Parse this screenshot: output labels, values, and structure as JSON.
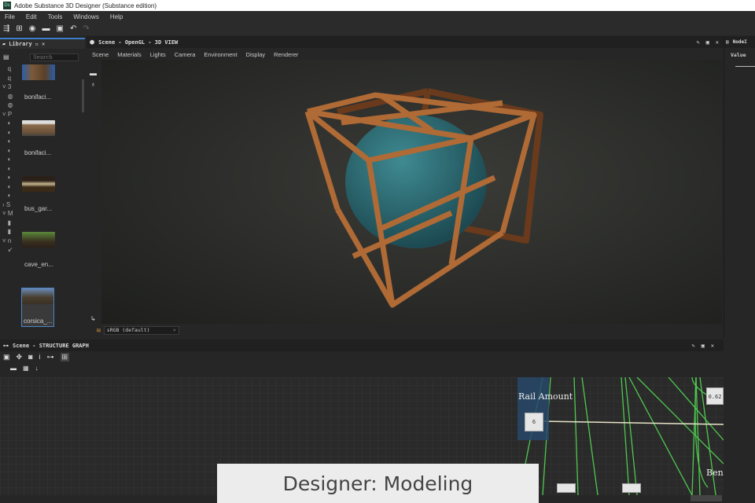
{
  "window": {
    "title": "Adobe Substance 3D Designer (Substance edition)",
    "logo": "Ds"
  },
  "menu": [
    "File",
    "Edit",
    "Tools",
    "Windows",
    "Help"
  ],
  "library": {
    "tab": "Library",
    "search_placeholder": "Search",
    "items": [
      "bonifaci...",
      "bonifaci...",
      "bus_gar...",
      "cave_en...",
      "corsica_..."
    ]
  },
  "scene": {
    "title": "Scene - OpenGL - 3D VIEW",
    "menu": [
      "Scene",
      "Materials",
      "Lights",
      "Camera",
      "Environment",
      "Display",
      "Renderer"
    ],
    "colorspace": "sRGB (default)"
  },
  "right_panel": {
    "title": "NodeI",
    "column": "Value"
  },
  "graph": {
    "title": "Scene - STRUCTURE GRAPH",
    "node_label": "Rail Amount",
    "node_value": "6",
    "node_b": "Ben",
    "node_c": "0.62"
  },
  "caption": "Designer: Modeling",
  "colors": {
    "accent": "#3d7cc9",
    "wire": "#b06a35",
    "sphere": "#2f6f78",
    "link": "#4fc94f"
  }
}
